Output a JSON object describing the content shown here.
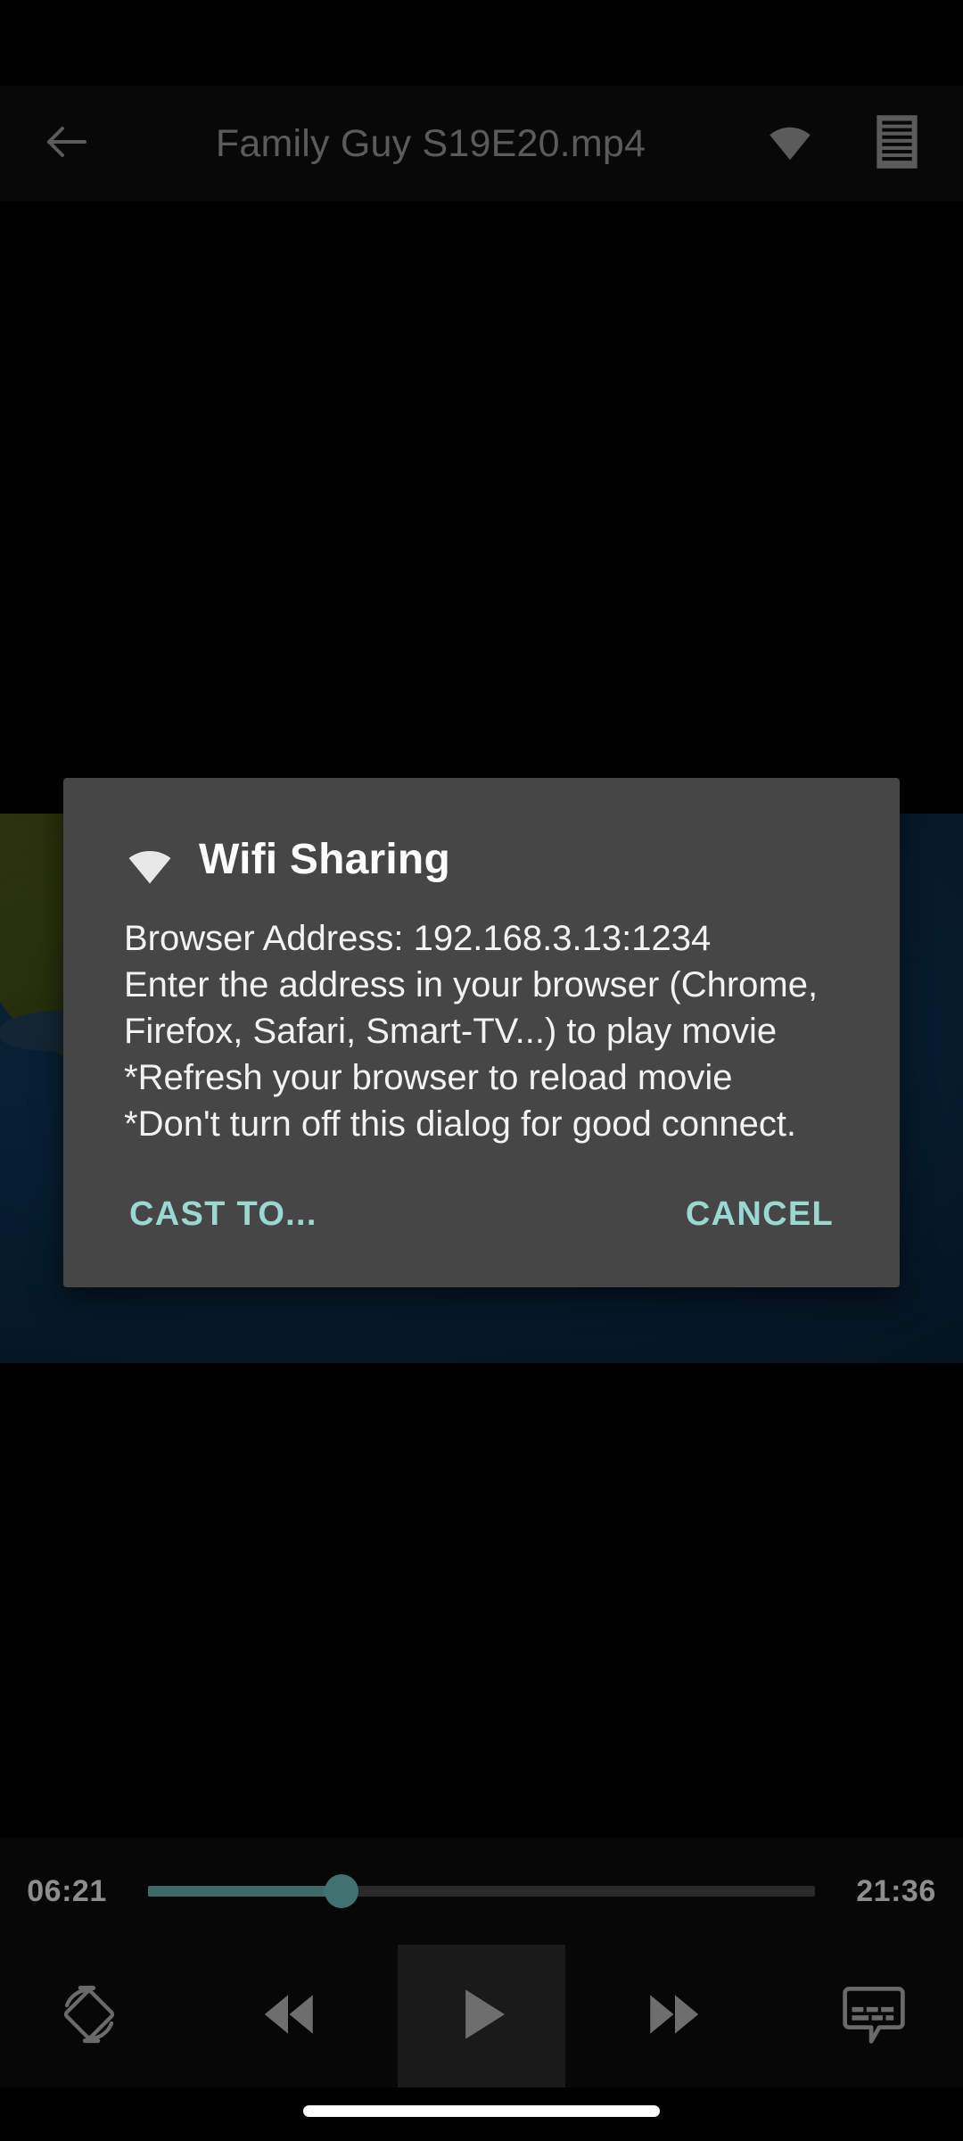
{
  "app": {
    "window_title": "Family Guy S19E20.mp4"
  },
  "toolbar": {
    "back_icon": "arrow-left-icon",
    "title": "Family Guy S19E20.mp4",
    "wifi_icon": "wifi-icon",
    "playlist_icon": "playlist-icon"
  },
  "dialog": {
    "icon": "wifi-icon",
    "title": "Wifi Sharing",
    "body": "Browser Address: 192.168.3.13:1234\nEnter the address in your browser (Chrome, Firefox, Safari, Smart-TV...) to play movie\n*Refresh your browser to reload movie\n*Don't turn off this dialog for good connect.",
    "browser_address": "192.168.3.13:1234",
    "positive_label": "CAST TO...",
    "negative_label": "CANCEL",
    "accent_color": "#9ad9d2",
    "surface_color": "#464646"
  },
  "player": {
    "current_time": "06:21",
    "total_time": "21:36",
    "progress_percent": 29,
    "seek_accent": "#3e7370",
    "controls": [
      {
        "name": "rotate-screen-icon",
        "label": "Rotate screen"
      },
      {
        "name": "rewind-icon",
        "label": "Rewind"
      },
      {
        "name": "play-icon",
        "label": "Play"
      },
      {
        "name": "fast-forward-icon",
        "label": "Fast forward"
      },
      {
        "name": "subtitles-icon",
        "label": "Subtitles"
      }
    ]
  },
  "system": {
    "nav_bar": "gesture-pill"
  }
}
